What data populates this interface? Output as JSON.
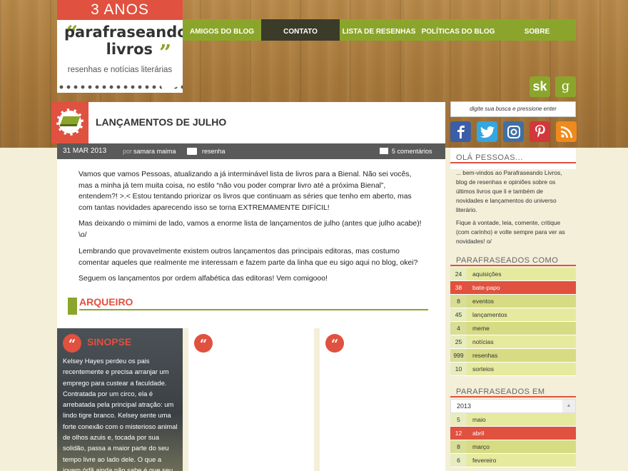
{
  "logo": {
    "anos": "3 ANOS",
    "name1": "parafraseando",
    "name2": "livros",
    "tagline": "resenhas e notícias literárias"
  },
  "nav": {
    "items": [
      "AMIGOS DO BLOG",
      "CONTATO",
      "LISTA DE RESENHAS",
      "POLÍTICAS DO BLOG",
      "SOBRE"
    ],
    "active": "CONTATO"
  },
  "social_top": {
    "skoob": "sk",
    "goodreads": "g"
  },
  "search": {
    "placeholder": "digite sua busca e pressione enter"
  },
  "social": {
    "facebook": "f",
    "twitter": "t",
    "instagram": "i",
    "pinterest": "p",
    "rss": "r"
  },
  "post": {
    "title": "LANÇAMENTOS DE JULHO",
    "date": "31 MAR 2013",
    "by": "por",
    "author": "samara maima",
    "category": "resenha",
    "comments": "5 comentários",
    "p1": "Vamos que vamos Pessoas, atualizando a já interminável lista de livros para a Bienal. Não sei vocês, mas a minha já tem muita coisa, no estilo “não vou poder comprar livro até a próxima Bienal”, entendem?! >.< Estou tentando priorizar os livros que continuam as séries que tenho em aberto, mas com tantas novidades aparecendo isso se torna EXTREMAMENTE DIFÍCIL!",
    "p2": "Mas deixando o mimimi de lado, vamos a enorme lista de lançamentos de julho (antes que julho acabe)! \\o/",
    "p3": "Lembrando que provavelmente existem outros lançamentos das principais editoras, mas costumo comentar aqueles que realmente me interessam e fazem parte da linha que eu sigo aqui no blog, okei?",
    "p4": "Seguem os lançamentos por ordem alfabética das editoras! Vem comigooo!"
  },
  "archive": {
    "title": "ARQUEIRO"
  },
  "cards": [
    {
      "heading": "SINOPSE",
      "synopsis": "Kelsey Hayes perdeu os pais recentemente e precisa arranjar um emprego para custear a faculdade. Contratada por um circo, ela é arrebatada pela principal atração: um lindo tigre branco. Kelsey sente uma forte conexão com o misterioso animal de olhos azuis e, tocada por sua solidão, passa a maior parte do seu tempo livre ao lado dele. O que a jovem órfã ainda não sabe é que seu"
    }
  ],
  "sidebar": {
    "hello_title": "OLÁ PESSOAS...",
    "hello_p1": "... bem-vindos ao Parafraseando Livros, blog de resenhas e opiniões sobre os últimos livros que li e também de novidades e lançamentos do universo literário.",
    "hello_p2": "Fique à vontade, leia, comente, critique (com carinho) e volte sempre para ver as novidades! o/",
    "tags_title": "PARAFRASEADOS COMO",
    "tags": [
      {
        "count": "24",
        "label": "aquisições"
      },
      {
        "count": "38",
        "label": "bate-papo"
      },
      {
        "count": "8",
        "label": "eventos"
      },
      {
        "count": "45",
        "label": "lançamentos"
      },
      {
        "count": "4",
        "label": "meme"
      },
      {
        "count": "25",
        "label": "notícias"
      },
      {
        "count": "999",
        "label": "resenhas"
      },
      {
        "count": "10",
        "label": "sorteios"
      }
    ],
    "archive_title": "PARAFRASEADOS EM",
    "year": "2013",
    "months": [
      {
        "count": "5",
        "label": "maio"
      },
      {
        "count": "12",
        "label": "abril"
      },
      {
        "count": "8",
        "label": "março"
      },
      {
        "count": "6",
        "label": "fevereiro"
      }
    ]
  },
  "colors": {
    "accent_red": "#e0513f",
    "accent_green": "#8ba52c",
    "dark": "#3b3b2a"
  }
}
